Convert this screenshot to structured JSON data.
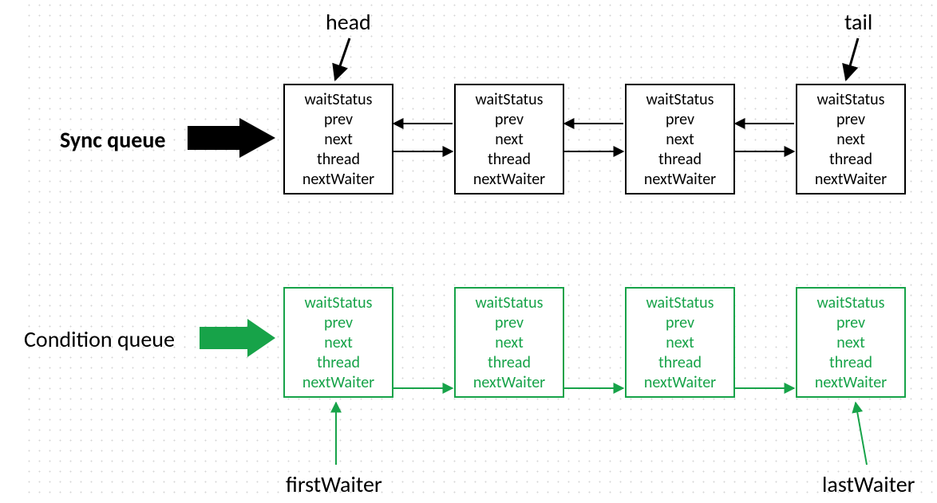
{
  "labels": {
    "head": "head",
    "tail": "tail",
    "sync_queue": "Sync queue",
    "condition_queue": "Condition queue",
    "first_waiter": "firstWaiter",
    "last_waiter": "lastWaiter"
  },
  "node_fields": [
    "waitStatus",
    "prev",
    "next",
    "thread",
    "nextWaiter"
  ],
  "colors": {
    "black": "#000000",
    "green": "#17a349"
  },
  "chart_data": {
    "type": "diagram",
    "queues": [
      {
        "name": "Sync queue",
        "color": "#000000",
        "link_direction": "bidirectional",
        "link_fields": [
          "prev",
          "next"
        ],
        "head_pointer_label": "head",
        "tail_pointer_label": "tail",
        "node_count": 4,
        "node_fields": [
          "waitStatus",
          "prev",
          "next",
          "thread",
          "nextWaiter"
        ]
      },
      {
        "name": "Condition queue",
        "color": "#17a349",
        "link_direction": "forward",
        "link_fields": [
          "nextWaiter"
        ],
        "head_pointer_label": "firstWaiter",
        "tail_pointer_label": "lastWaiter",
        "node_count": 4,
        "node_fields": [
          "waitStatus",
          "prev",
          "next",
          "thread",
          "nextWaiter"
        ]
      }
    ]
  }
}
